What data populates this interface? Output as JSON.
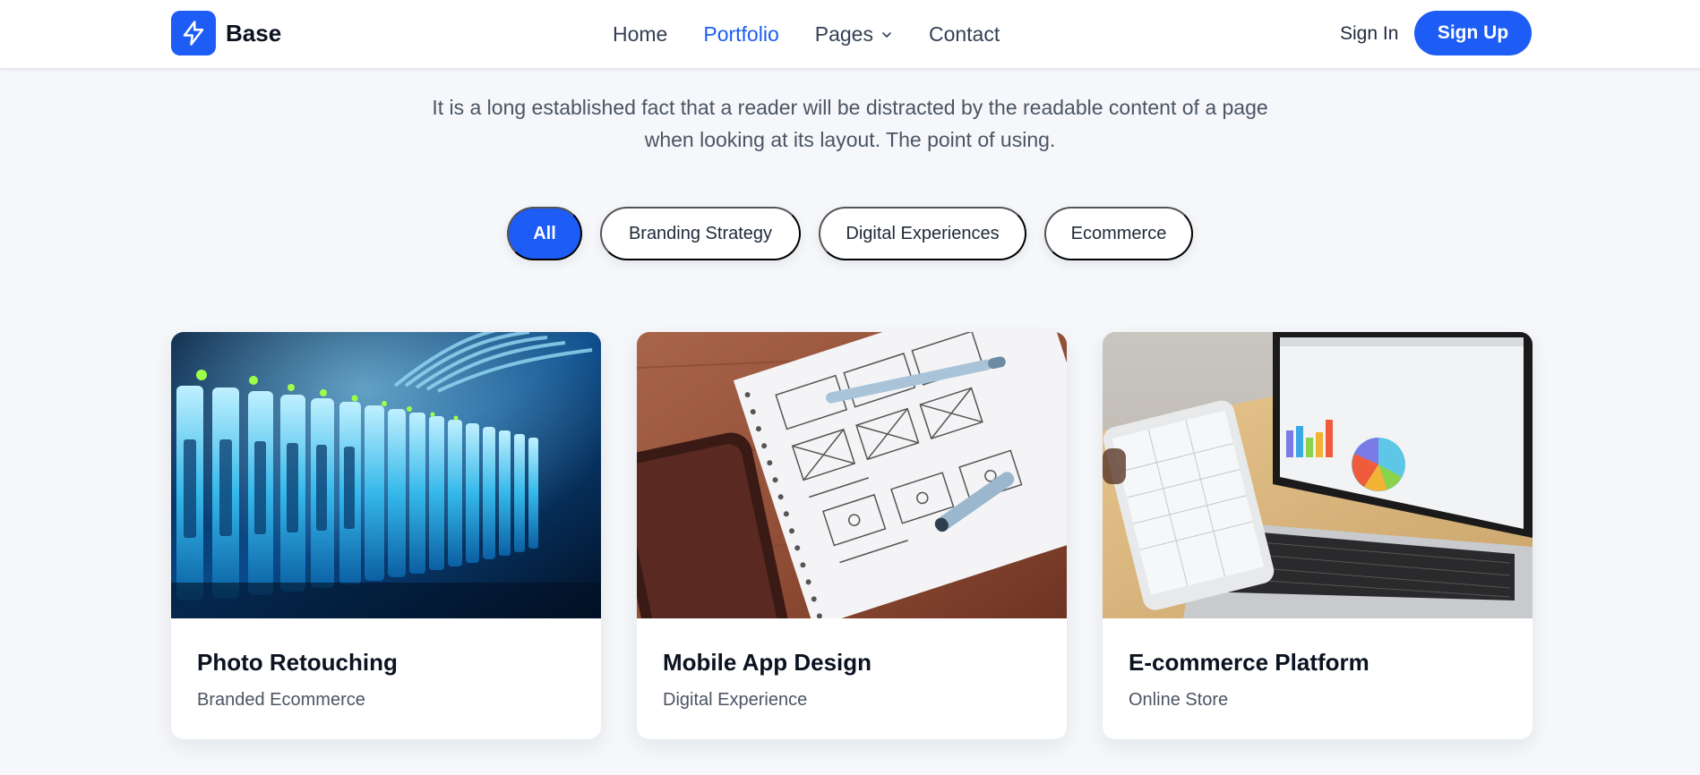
{
  "brand": {
    "name": "Base",
    "icon": "lightning-bolt-icon",
    "accent": "#1d5cf5"
  },
  "nav": {
    "items": [
      {
        "label": "Home",
        "active": false
      },
      {
        "label": "Portfolio",
        "active": true
      },
      {
        "label": "Pages",
        "active": false,
        "dropdown": true
      },
      {
        "label": "Contact",
        "active": false
      }
    ]
  },
  "auth": {
    "sign_in": "Sign In",
    "sign_up": "Sign Up"
  },
  "intro": {
    "line1": "It is a long established fact that a reader will be distracted by the readable content of a page",
    "line2": "when looking at its layout. The point of using."
  },
  "filters": [
    {
      "label": "All",
      "active": true
    },
    {
      "label": "Branding Strategy",
      "active": false
    },
    {
      "label": "Digital Experiences",
      "active": false
    },
    {
      "label": "Ecommerce",
      "active": false
    }
  ],
  "cards": [
    {
      "title": "Photo Retouching",
      "subtitle": "Branded Ecommerce",
      "image": "server-rack-photo"
    },
    {
      "title": "Mobile App Design",
      "subtitle": "Digital Experience",
      "image": "wireframe-sketch-photo"
    },
    {
      "title": "E-commerce Platform",
      "subtitle": "Online Store",
      "image": "laptop-dashboard-photo"
    }
  ]
}
